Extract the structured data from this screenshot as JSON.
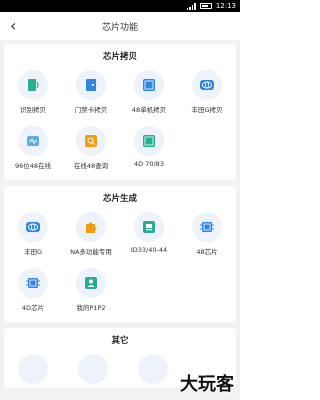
{
  "status": {
    "time": "12:13"
  },
  "nav": {
    "back_glyph": "‹",
    "title": "芯片功能"
  },
  "sections": [
    {
      "title": "芯片拷贝",
      "items": [
        {
          "label": "识别拷贝",
          "icon": "nfc-scan-icon"
        },
        {
          "label": "门禁卡拷贝",
          "icon": "door-card-icon"
        },
        {
          "label": "48单机拷贝",
          "icon": "chip-48-icon"
        },
        {
          "label": "丰田G拷贝",
          "icon": "toyota-icon"
        },
        {
          "label": "96位48在线",
          "icon": "chip-96-icon"
        },
        {
          "label": "在线48查询",
          "icon": "search-48-icon"
        },
        {
          "label": "4D 70/83",
          "icon": "chip-4d-icon"
        }
      ]
    },
    {
      "title": "芯片生成",
      "items": [
        {
          "label": "丰田G",
          "icon": "toyota-icon"
        },
        {
          "label": "NA多功能专用",
          "icon": "puzzle-icon"
        },
        {
          "label": "ID33/40-44",
          "icon": "chip-id-icon"
        },
        {
          "label": "48芯片",
          "icon": "chip-48-icon"
        },
        {
          "label": "4D芯片",
          "icon": "chip-4d-icon"
        },
        {
          "label": "我的P1P2",
          "icon": "profile-card-icon"
        }
      ]
    },
    {
      "title": "其它",
      "items": []
    }
  ],
  "watermark": "大玩客",
  "colors": {
    "accent": "#2e86de",
    "green": "#27ae8f",
    "orange": "#f39c12",
    "background": "#f2f2f2"
  }
}
